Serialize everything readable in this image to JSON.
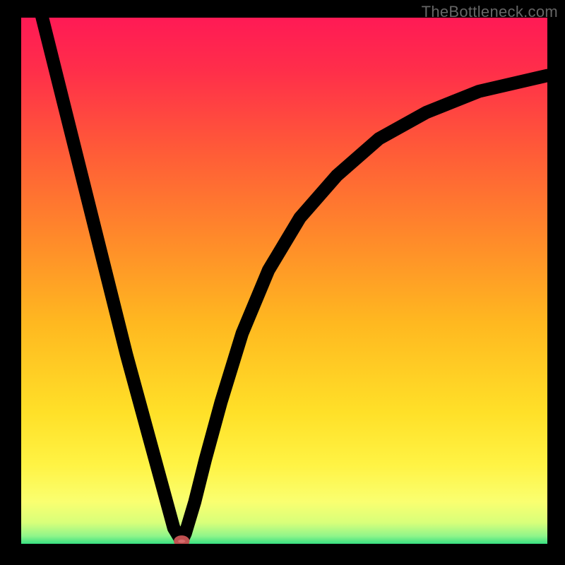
{
  "watermark": "TheBottleneck.com",
  "chart_data": {
    "type": "line",
    "title": "",
    "xlabel": "",
    "ylabel": "",
    "xlim": [
      0,
      100
    ],
    "ylim": [
      0,
      100
    ],
    "background": {
      "style": "vertical-gradient",
      "stops": [
        {
          "pos": 0.0,
          "color": "#ff1a55"
        },
        {
          "pos": 0.1,
          "color": "#ff2e4a"
        },
        {
          "pos": 0.25,
          "color": "#ff5a38"
        },
        {
          "pos": 0.42,
          "color": "#ff8a2a"
        },
        {
          "pos": 0.58,
          "color": "#ffb820"
        },
        {
          "pos": 0.75,
          "color": "#ffe028"
        },
        {
          "pos": 0.85,
          "color": "#fff344"
        },
        {
          "pos": 0.92,
          "color": "#faff70"
        },
        {
          "pos": 0.96,
          "color": "#d8ff7a"
        },
        {
          "pos": 0.985,
          "color": "#90f58a"
        },
        {
          "pos": 1.0,
          "color": "#38e082"
        }
      ]
    },
    "series": [
      {
        "name": "bottleneck-curve",
        "x": [
          0,
          2,
          5,
          8,
          11,
          14,
          17,
          20,
          23,
          26,
          29,
          30.5,
          31.2,
          33,
          35,
          38,
          42,
          47,
          53,
          60,
          68,
          77,
          87,
          100
        ],
        "y": [
          116,
          108,
          96,
          84,
          72,
          60,
          48,
          36,
          25,
          14,
          3,
          0.5,
          2,
          8,
          16,
          27,
          40,
          52,
          62,
          70,
          77,
          82,
          86,
          89
        ]
      }
    ],
    "marker": {
      "name": "minimum-point",
      "x": 30.5,
      "y": 0.5,
      "shape": "ellipse",
      "color": "#d66b6b"
    }
  }
}
